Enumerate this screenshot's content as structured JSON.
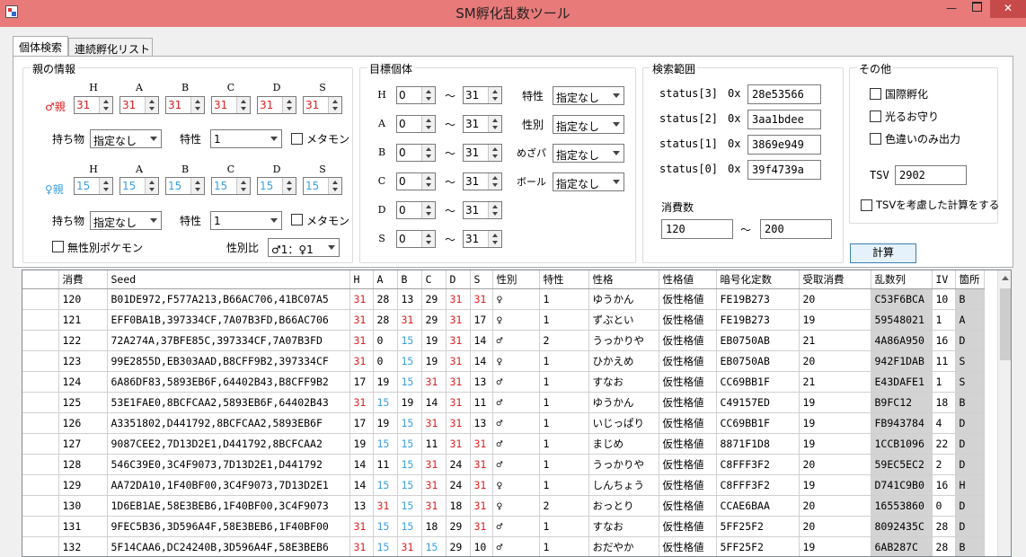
{
  "window": {
    "title": "SM孵化乱数ツール"
  },
  "tabs": [
    "個体検索",
    "連続孵化リスト"
  ],
  "parent": {
    "group": "親の情報",
    "stat_headers": [
      "H",
      "A",
      "B",
      "C",
      "D",
      "S"
    ],
    "male_label": "♂親",
    "male_ivs": [
      "31",
      "31",
      "31",
      "31",
      "31",
      "31"
    ],
    "female_label": "♀親",
    "female_ivs": [
      "15",
      "15",
      "15",
      "15",
      "15",
      "15"
    ],
    "item_label": "持ち物",
    "item_value": "指定なし",
    "ability_label": "特性",
    "ability_value": "1",
    "ditto_label": "メタモン",
    "item2_value": "指定なし",
    "ability2_value": "1",
    "genderless_label": "無性別ポケモン",
    "ratio_label": "性別比",
    "ratio_value": "♂1：♀1"
  },
  "target": {
    "group": "目標個体",
    "rows": [
      {
        "stat": "H",
        "min": "0",
        "max": "31"
      },
      {
        "stat": "A",
        "min": "0",
        "max": "31"
      },
      {
        "stat": "B",
        "min": "0",
        "max": "31"
      },
      {
        "stat": "C",
        "min": "0",
        "max": "31"
      },
      {
        "stat": "D",
        "min": "0",
        "max": "31"
      },
      {
        "stat": "S",
        "min": "0",
        "max": "31"
      }
    ],
    "tilde": "～",
    "ability_label": "特性",
    "ability_value": "指定なし",
    "gender_label": "性別",
    "gender_value": "指定なし",
    "hp_label": "めざパ",
    "hp_value": "指定なし",
    "ball_label": "ボール",
    "ball_value": "指定なし"
  },
  "search": {
    "group": "検索範囲",
    "status": [
      {
        "label": "status[3]",
        "prefix": "0x",
        "value": "28e53566"
      },
      {
        "label": "status[2]",
        "prefix": "0x",
        "value": "3aa1bdee"
      },
      {
        "label": "status[1]",
        "prefix": "0x",
        "value": "3869e949"
      },
      {
        "label": "status[0]",
        "prefix": "0x",
        "value": "39f4739a"
      }
    ],
    "consume_label": "消費数",
    "consume_min": "120",
    "consume_max": "200",
    "tilde": "～"
  },
  "other": {
    "group": "その他",
    "intl": "国際孵化",
    "charm": "光るお守り",
    "shiny_only": "色違いのみ出力",
    "tsv_label": "TSV",
    "tsv_value": "2902",
    "tsv_calc": "TSVを考慮した計算をする"
  },
  "calc_button": "計算",
  "table": {
    "columns": [
      "",
      "消費",
      "Seed",
      "H",
      "A",
      "B",
      "C",
      "D",
      "S",
      "性別",
      "特性",
      "性格",
      "性格値",
      "暗号化定数",
      "受取消費",
      "乱数列",
      "IV",
      "箇所"
    ],
    "rows": [
      [
        "120",
        "B01DE972,F577A213,B66AC706,41BC07A5",
        "31",
        "28",
        "13",
        "29",
        "31",
        "31",
        "♀",
        "1",
        "ゆうかん",
        "仮性格値",
        "FE19B273",
        "20",
        "C53F6BCA",
        "10",
        "B"
      ],
      [
        "121",
        "EFF0BA1B,397334CF,7A07B3FD,B66AC706",
        "31",
        "28",
        "31",
        "29",
        "31",
        "17",
        "♀",
        "1",
        "ずぶとい",
        "仮性格値",
        "FE19B273",
        "19",
        "59548021",
        "1",
        "A"
      ],
      [
        "122",
        "72A274A,37BFE85C,397334CF,7A07B3FD",
        "31",
        "0",
        "15",
        "19",
        "31",
        "14",
        "♂",
        "2",
        "うっかりや",
        "仮性格値",
        "EB0750AB",
        "21",
        "4A86A950",
        "16",
        "D"
      ],
      [
        "123",
        "99E2855D,EB303AAD,B8CFF9B2,397334CF",
        "31",
        "0",
        "15",
        "19",
        "31",
        "14",
        "♀",
        "1",
        "ひかえめ",
        "仮性格値",
        "EB0750AB",
        "20",
        "942F1DAB",
        "11",
        "S"
      ],
      [
        "124",
        "6A86DF83,5893EB6F,64402B43,B8CFF9B2",
        "17",
        "19",
        "15",
        "31",
        "31",
        "13",
        "♂",
        "1",
        "すなお",
        "仮性格値",
        "CC69BB1F",
        "21",
        "E43DAFE1",
        "1",
        "S"
      ],
      [
        "125",
        "53E1FAE0,8BCFCAA2,5893EB6F,64402B43",
        "31",
        "15",
        "19",
        "14",
        "31",
        "11",
        "♂",
        "1",
        "ゆうかん",
        "仮性格値",
        "C49157ED",
        "19",
        "B9FC12",
        "18",
        "B"
      ],
      [
        "126",
        "A3351802,D441792,8BCFCAA2,5893EB6F",
        "17",
        "19",
        "15",
        "31",
        "31",
        "13",
        "♂",
        "1",
        "いじっぱり",
        "仮性格値",
        "CC69BB1F",
        "19",
        "FB943784",
        "4",
        "D"
      ],
      [
        "127",
        "9087CEE2,7D13D2E1,D441792,8BCFCAA2",
        "19",
        "15",
        "15",
        "11",
        "31",
        "31",
        "♂",
        "1",
        "まじめ",
        "仮性格値",
        "8871F1D8",
        "19",
        "1CCB1096",
        "22",
        "D"
      ],
      [
        "128",
        "546C39E0,3C4F9073,7D13D2E1,D441792",
        "14",
        "11",
        "15",
        "31",
        "24",
        "31",
        "♂",
        "1",
        "うっかりや",
        "仮性格値",
        "C8FFF3F2",
        "20",
        "59EC5EC2",
        "2",
        "D"
      ],
      [
        "129",
        "AA72DA10,1F40BF00,3C4F9073,7D13D2E1",
        "14",
        "15",
        "15",
        "31",
        "24",
        "31",
        "♀",
        "1",
        "しんちょう",
        "仮性格値",
        "C8FFF3F2",
        "19",
        "D741C9B0",
        "16",
        "H"
      ],
      [
        "130",
        "1D6EB1AE,58E3BEB6,1F40BF00,3C4F9073",
        "13",
        "31",
        "15",
        "31",
        "18",
        "31",
        "♀",
        "2",
        "おっとり",
        "仮性格値",
        "CCAE6BAA",
        "20",
        "16553860",
        "0",
        "D"
      ],
      [
        "131",
        "9FEC5B36,3D596A4F,58E3BEB6,1F40BF00",
        "31",
        "15",
        "15",
        "18",
        "29",
        "31",
        "♂",
        "1",
        "すなお",
        "仮性格値",
        "5FF25F2",
        "20",
        "8092435C",
        "28",
        "D"
      ],
      [
        "132",
        "5F14CAA6,DC24240B,3D596A4F,58E3BEB6",
        "31",
        "15",
        "31",
        "15",
        "29",
        "10",
        "♂",
        "1",
        "おだやか",
        "仮性格値",
        "5FF25F2",
        "19",
        "6AB287C",
        "28",
        "B"
      ]
    ]
  },
  "colors": {
    "male": "#e02020",
    "female": "#3aa0e0",
    "iv_high": "#e02020",
    "iv_low": "#3aa0e0",
    "titlebar": "#e87a7a"
  }
}
